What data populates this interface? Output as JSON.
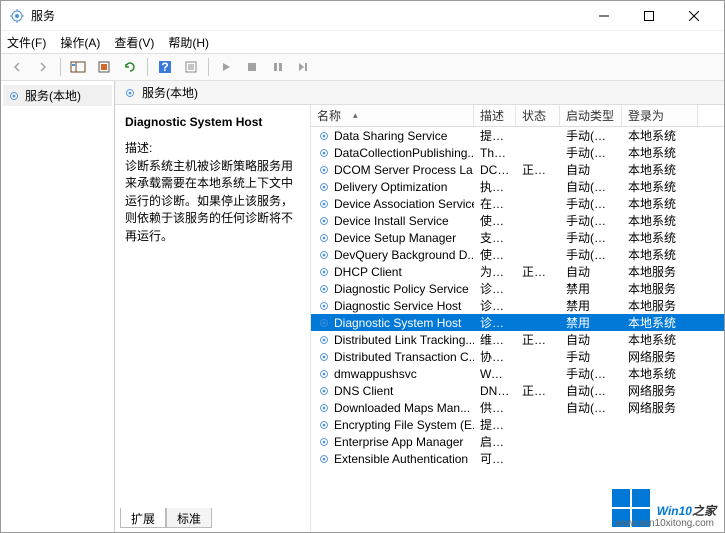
{
  "window": {
    "title": "服务"
  },
  "menus": [
    "文件(F)",
    "操作(A)",
    "查看(V)",
    "帮助(H)"
  ],
  "tree": {
    "root": "服务(本地)"
  },
  "pane_header": "服务(本地)",
  "detail": {
    "title": "Diagnostic System Host",
    "desc_label": "描述:",
    "desc": "诊断系统主机被诊断策略服务用来承载需要在本地系统上下文中运行的诊断。如果停止该服务，则依赖于该服务的任何诊断将不再运行。"
  },
  "columns": {
    "name": "名称",
    "desc": "描述",
    "status": "状态",
    "startup": "启动类型",
    "logon": "登录为"
  },
  "services": [
    {
      "name": "Data Sharing Service",
      "desc": "提供...",
      "status": "",
      "startup": "手动(触发...",
      "logon": "本地系统"
    },
    {
      "name": "DataCollectionPublishing...",
      "desc": "The ...",
      "status": "",
      "startup": "手动(触发...",
      "logon": "本地系统"
    },
    {
      "name": "DCOM Server Process La...",
      "desc": "DCO...",
      "status": "正在...",
      "startup": "自动",
      "logon": "本地系统"
    },
    {
      "name": "Delivery Optimization",
      "desc": "执行...",
      "status": "",
      "startup": "自动(延迟...",
      "logon": "本地系统"
    },
    {
      "name": "Device Association Service",
      "desc": "在系...",
      "status": "",
      "startup": "手动(触发...",
      "logon": "本地系统"
    },
    {
      "name": "Device Install Service",
      "desc": "使计...",
      "status": "",
      "startup": "手动(触发...",
      "logon": "本地系统"
    },
    {
      "name": "Device Setup Manager",
      "desc": "支持...",
      "status": "",
      "startup": "手动(触发...",
      "logon": "本地系统"
    },
    {
      "name": "DevQuery Background D...",
      "desc": "使应...",
      "status": "",
      "startup": "手动(触发...",
      "logon": "本地系统"
    },
    {
      "name": "DHCP Client",
      "desc": "为此...",
      "status": "正在...",
      "startup": "自动",
      "logon": "本地服务"
    },
    {
      "name": "Diagnostic Policy Service",
      "desc": "诊断...",
      "status": "",
      "startup": "禁用",
      "logon": "本地服务"
    },
    {
      "name": "Diagnostic Service Host",
      "desc": "诊断...",
      "status": "",
      "startup": "禁用",
      "logon": "本地服务"
    },
    {
      "name": "Diagnostic System Host",
      "desc": "诊断...",
      "status": "",
      "startup": "禁用",
      "logon": "本地系统",
      "selected": true
    },
    {
      "name": "Distributed Link Tracking...",
      "desc": "维护...",
      "status": "正在...",
      "startup": "自动",
      "logon": "本地系统"
    },
    {
      "name": "Distributed Transaction C...",
      "desc": "协调...",
      "status": "",
      "startup": "手动",
      "logon": "网络服务"
    },
    {
      "name": "dmwappushsvc",
      "desc": "WAP...",
      "status": "",
      "startup": "手动(触发...",
      "logon": "本地系统"
    },
    {
      "name": "DNS Client",
      "desc": "DNS ...",
      "status": "正在...",
      "startup": "自动(触发...",
      "logon": "网络服务"
    },
    {
      "name": "Downloaded Maps Man...",
      "desc": "供应...",
      "status": "",
      "startup": "自动(延迟...",
      "logon": "网络服务"
    },
    {
      "name": "Encrypting File System (E...",
      "desc": "提供...",
      "status": "",
      "startup": "",
      "logon": ""
    },
    {
      "name": "Enterprise App Manager",
      "desc": "启用...",
      "status": "",
      "startup": "",
      "logon": ""
    },
    {
      "name": "Extensible Authentication",
      "desc": "可扩...",
      "status": "",
      "startup": "",
      "logon": ""
    }
  ],
  "tabs": {
    "extended": "扩展",
    "standard": "标准"
  },
  "watermark": {
    "brand1": "Win",
    "brand2": "10",
    "brand3": "之家",
    "url": "www.win10xitong.com"
  }
}
